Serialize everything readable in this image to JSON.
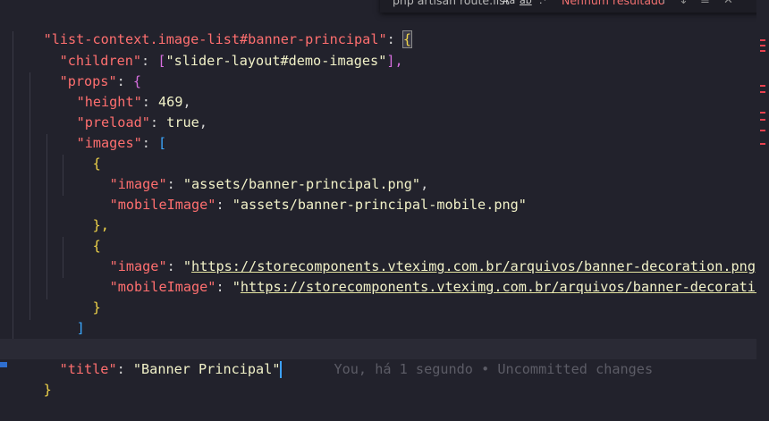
{
  "find_widget": {
    "query": "php artisan route:list",
    "match_case": "Aa",
    "whole_word": "ab",
    "regex": ".*",
    "result": "Nenhum resultado",
    "prev": "↑",
    "next": "↓",
    "selection": "≡",
    "close": "✕"
  },
  "code": {
    "l1_key": "\"list-context.image-list#banner-principal\"",
    "l1_colon": ": ",
    "l1_open": "{",
    "l2_key": "\"children\"",
    "l2_colon": ": ",
    "l2_open": "[",
    "l2_val": "\"slider-layout#demo-images\"",
    "l2_close": "],",
    "l3_key": "\"props\"",
    "l3_colon": ": ",
    "l3_open": "{",
    "l4_key": "\"height\"",
    "l4_colon": ": ",
    "l4_val": "469",
    "l4_comma": ",",
    "l5_key": "\"preload\"",
    "l5_colon": ": ",
    "l5_val": "true",
    "l5_comma": ",",
    "l6_key": "\"images\"",
    "l6_colon": ": ",
    "l6_open": "[",
    "l7_open": "{",
    "l8_key": "\"image\"",
    "l8_colon": ": ",
    "l8_val": "\"assets/banner-principal.png\"",
    "l8_comma": ",",
    "l9_key": "\"mobileImage\"",
    "l9_colon": ": ",
    "l9_val": "\"assets/banner-principal-mobile.png\"",
    "l10_close": "},",
    "l11_open": "{",
    "l12_key": "\"image\"",
    "l12_colon": ": ",
    "l12_q1": "\"",
    "l12_url": "https://storecomponents.vteximg.com.br/arquivos/banner-decoration.png",
    "l12_q2": "\",",
    "l13_key": "\"mobileImage\"",
    "l13_colon": ": ",
    "l13_q1": "\"",
    "l13_url": "https://storecomponents.vteximg.com.br/arquivos/banner-decoration",
    "l14_close": "}",
    "l15_close": "]",
    "l16_close": "},",
    "l17_key": "\"title\"",
    "l17_colon": ": ",
    "l17_val": "\"Banner Principal\"",
    "blame": "You, há 1 segundo • Uncommitted changes",
    "l18_close": "}"
  },
  "colors": {
    "background": "#22222c",
    "key": "#ff6f6f",
    "string": "#f1f1c8",
    "bracket_level1": "#f1d54a",
    "bracket_level2": "#d86fe0",
    "bracket_level3": "#3ba8ff",
    "cursor": "#3da2ff",
    "find_no_results": "#f17070"
  }
}
